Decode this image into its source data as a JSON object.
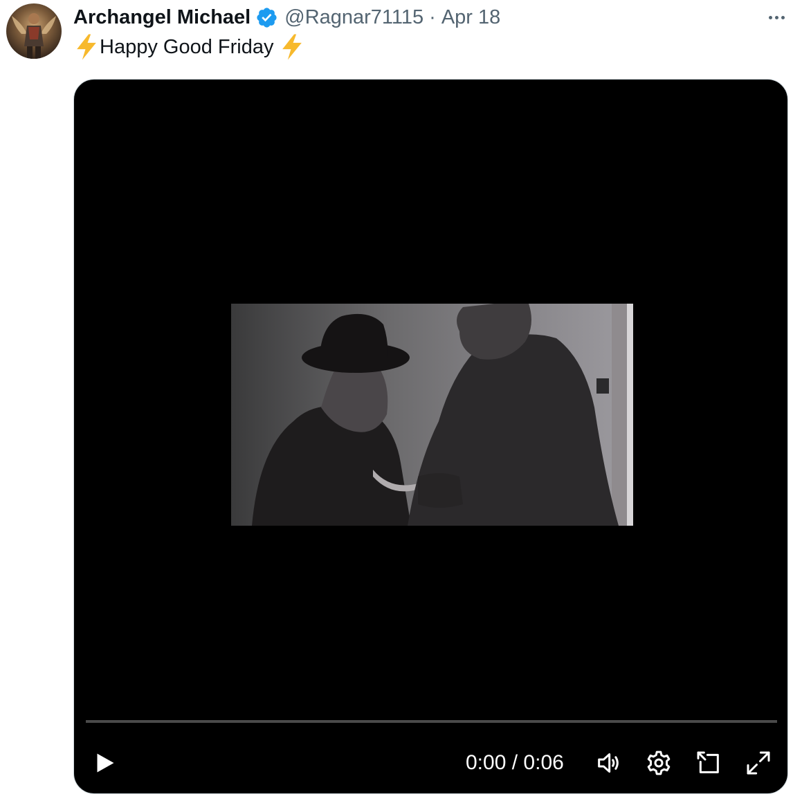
{
  "author": {
    "name": "Archangel Michael",
    "handle": "@Ragnar71115",
    "separator": "·",
    "date": "Apr 18",
    "verified": true,
    "verified_color": "#1d9bf0"
  },
  "tweet": {
    "text": "Happy Good Friday",
    "leading_emoji": "lightning-bolt",
    "trailing_emoji": "lightning-bolt"
  },
  "video": {
    "current_time": "0:00",
    "time_separator": "/",
    "duration": "0:06",
    "progress": 0,
    "controls": [
      "play-icon",
      "volume-icon",
      "settings-icon",
      "pop-out-icon",
      "fullscreen-icon"
    ]
  },
  "colors": {
    "text": "#0f1419",
    "secondary": "#536471",
    "emoji_bolt": "#f7b92d"
  }
}
